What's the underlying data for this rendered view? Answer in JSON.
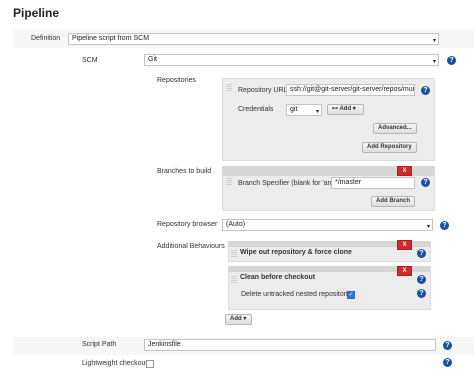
{
  "page": {
    "title": "Pipeline"
  },
  "definition": {
    "label": "Definition",
    "value": "Pipeline script from SCM"
  },
  "scm": {
    "label": "SCM",
    "value": "Git"
  },
  "repositories": {
    "label": "Repositories",
    "url_label": "Repository URL",
    "url_value": "ssh://git@git-server/git-server/repos/murder.g",
    "credentials_label": "Credentials",
    "credentials_value": "git",
    "add_label": "Add",
    "advanced_label": "Advanced...",
    "add_repository_label": "Add Repository"
  },
  "branches": {
    "label": "Branches to build",
    "specifier_label": "Branch Specifier (blank for 'any')",
    "specifier_value": "*/master",
    "add_branch_label": "Add Branch",
    "delete_label": "X"
  },
  "browser": {
    "label": "Repository browser",
    "value": "(Auto)"
  },
  "behaviours": {
    "label": "Additional Behaviours",
    "items": [
      {
        "title": "Wipe out repository & force clone",
        "delete_label": "X"
      },
      {
        "title": "Clean before checkout",
        "delete_label": "X",
        "option_label": "Delete untracked nested repositories",
        "option_checked": true
      }
    ],
    "add_label": "Add"
  },
  "script_path": {
    "label": "Script Path",
    "value": "Jenkinsfile"
  },
  "lightweight": {
    "label": "Lightweight checkout",
    "checked": false
  },
  "icons": {
    "help": "help-icon",
    "dropdown": "chevron-down-icon",
    "key": "key-icon"
  },
  "colors": {
    "help": "#1b4fa3",
    "delete": "#cf2a2a",
    "checkbox_on": "#2f6fcf"
  }
}
